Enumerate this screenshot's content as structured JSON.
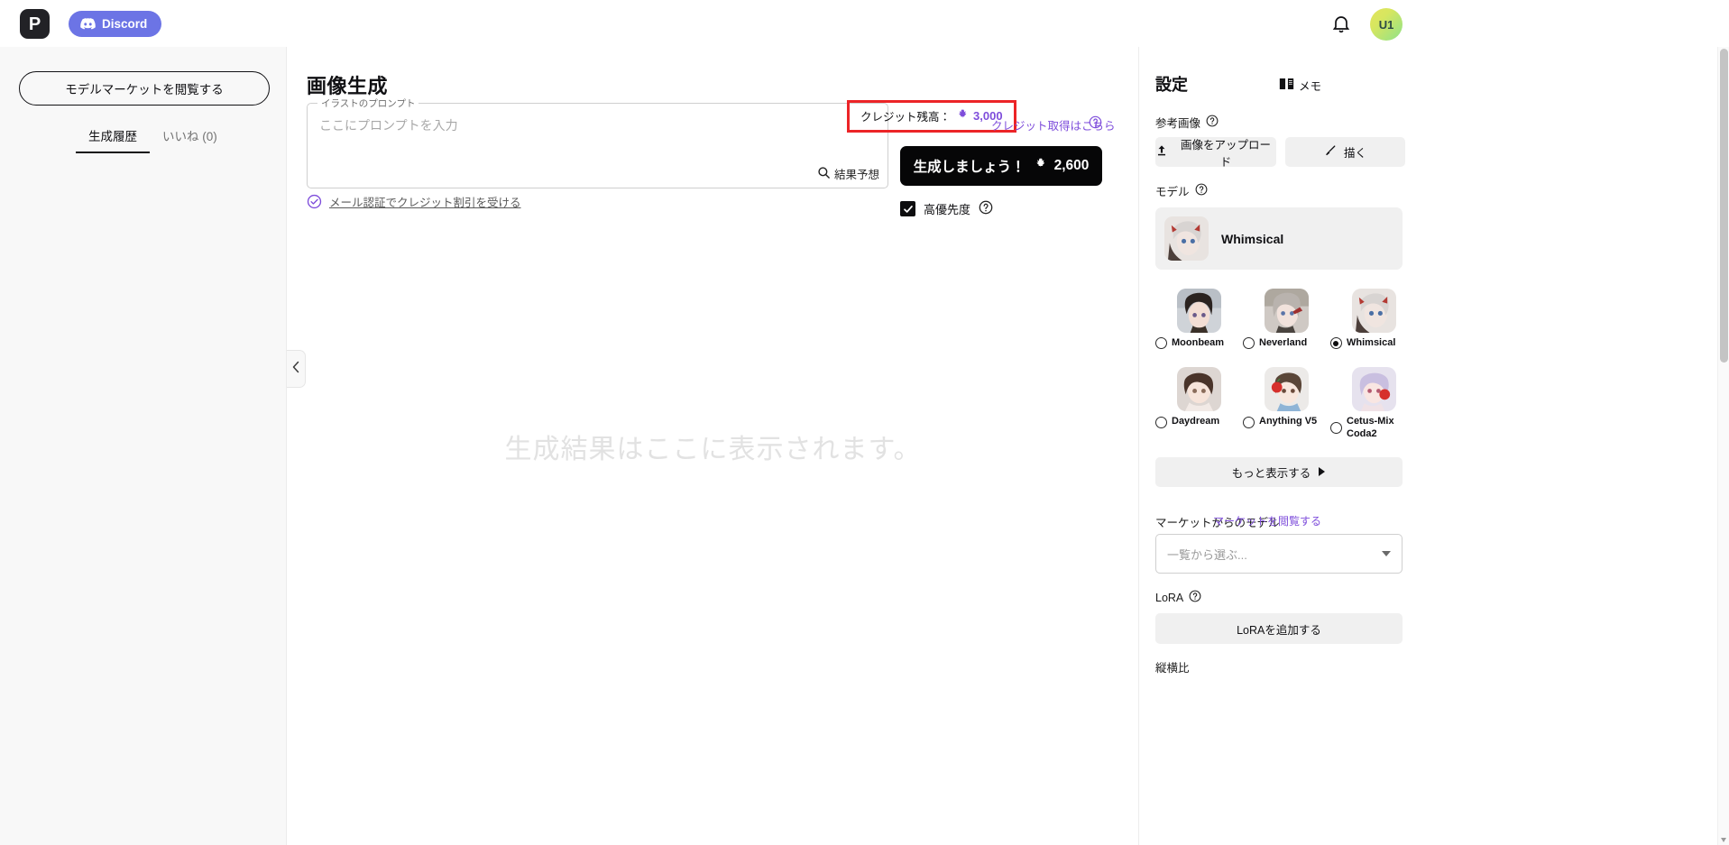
{
  "topbar": {
    "logo_text": "P",
    "discord_label": "Discord",
    "avatar_initials": "U1"
  },
  "sidebar": {
    "market_button": "モデルマーケットを閲覧する",
    "tabs": [
      {
        "label": "生成履歴",
        "active": true
      },
      {
        "label": "いいね (0)",
        "active": false
      }
    ]
  },
  "main": {
    "page_title": "画像生成",
    "prompt": {
      "legend": "イラストのプロンプト",
      "placeholder": "ここにプロンプトを入力",
      "value": "",
      "predict_label": "結果予想"
    },
    "verify_link": "メール認証でクレジット割引を受ける",
    "credit": {
      "label": "クレジット残高：",
      "amount": "3,000",
      "get_credit_link": "クレジット取得はこちら",
      "highlight_color": "#ec2427",
      "accent_color": "#7e4ddb"
    },
    "generate": {
      "label": "生成しましょう！",
      "cost": "2,600"
    },
    "high_priority": {
      "label": "高優先度",
      "checked": true
    },
    "result_placeholder": "生成結果はここに表示されます。"
  },
  "settings": {
    "title": "設定",
    "memo_label": "メモ",
    "reference_image": {
      "label": "参考画像",
      "upload_button": "画像をアップロード",
      "draw_button": "描く"
    },
    "model": {
      "label": "モデル",
      "selected_name": "Whimsical",
      "options": [
        {
          "name": "Moonbeam",
          "selected": false
        },
        {
          "name": "Neverland",
          "selected": false
        },
        {
          "name": "Whimsical",
          "selected": true
        },
        {
          "name": "Daydream",
          "selected": false
        },
        {
          "name": "Anything V5",
          "selected": false
        },
        {
          "name": "Cetus-Mix Coda2",
          "selected": false
        }
      ],
      "show_more": "もっと表示する"
    },
    "market": {
      "label": "マーケットからのモデル",
      "browse_link": "マーケットを閲覧する",
      "select_placeholder": "一覧から選ぶ..."
    },
    "lora": {
      "label": "LoRA",
      "add_button": "LoRAを追加する"
    },
    "aspect_ratio": {
      "label": "縦横比"
    }
  },
  "icons": {
    "discord": "discord-icon",
    "bell": "bell-icon",
    "search": "search-icon",
    "help": "help-circle-icon",
    "check_badge": "check-circle-icon",
    "coin": "credit-coin-icon",
    "upload": "upload-icon",
    "brush": "brush-icon",
    "book": "book-icon",
    "chevron_left": "chevron-left-icon",
    "chevron_right": "chevron-right-icon",
    "caret_down": "chevron-down-icon"
  }
}
